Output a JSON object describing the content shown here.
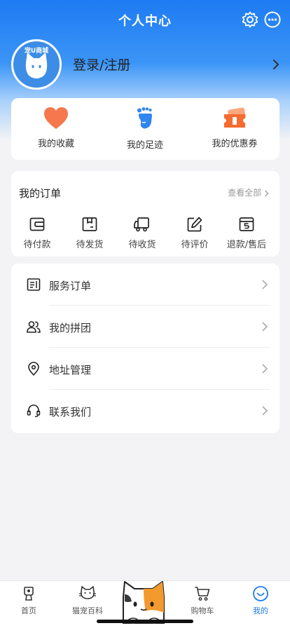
{
  "header": {
    "title": "个人中心"
  },
  "profile": {
    "avatar_logo_text": "宠U商城",
    "login_label": "登录/注册"
  },
  "shortcuts": [
    {
      "label": "我的收藏",
      "icon": "heart-icon"
    },
    {
      "label": "我的足迹",
      "icon": "footprint-icon"
    },
    {
      "label": "我的优惠券",
      "icon": "coupon-icon"
    }
  ],
  "orders": {
    "title": "我的订单",
    "view_all": "查看全部",
    "items": [
      {
        "label": "待付款",
        "icon": "wallet-icon"
      },
      {
        "label": "待发货",
        "icon": "package-icon"
      },
      {
        "label": "待收货",
        "icon": "truck-icon"
      },
      {
        "label": "待评价",
        "icon": "edit-icon"
      },
      {
        "label": "退款/售后",
        "icon": "refund-icon"
      }
    ]
  },
  "menu": [
    {
      "label": "服务订单",
      "icon": "service-order-icon"
    },
    {
      "label": "我的拼团",
      "icon": "group-buy-icon"
    },
    {
      "label": "地址管理",
      "icon": "location-icon"
    },
    {
      "label": "联系我们",
      "icon": "headset-icon"
    }
  ],
  "tabbar": [
    {
      "label": "首页",
      "icon": "home-pet-icon"
    },
    {
      "label": "猫宠百科",
      "icon": "cat-icon"
    },
    {
      "label": "购物车",
      "icon": "cart-icon"
    },
    {
      "label": "我的",
      "icon": "smile-icon",
      "active": true
    }
  ],
  "colors": {
    "accent": "#1e7bf2",
    "heart": "#f5774d",
    "foot": "#2f86f0",
    "coupon": "#f56b30"
  }
}
